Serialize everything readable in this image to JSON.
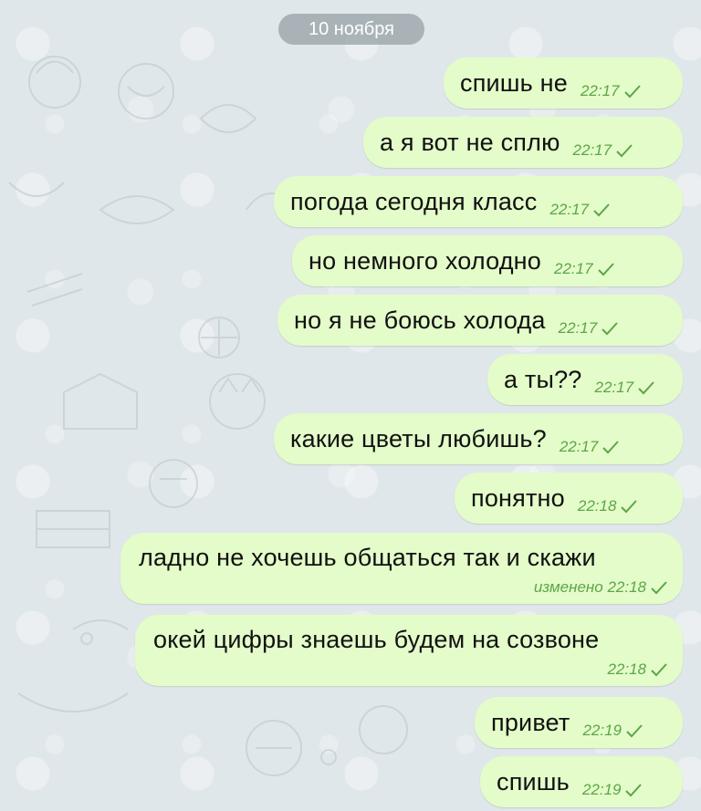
{
  "chat": {
    "date_label": "10 ноября",
    "messages": [
      {
        "text": "спишь не",
        "time": "22:17"
      },
      {
        "text": "а я вот не сплю",
        "time": "22:17"
      },
      {
        "text": "погода сегодня класс",
        "time": "22:17"
      },
      {
        "text": "но немного холодно",
        "time": "22:17"
      },
      {
        "text": "но я не боюсь холода",
        "time": "22:17"
      },
      {
        "text": "а ты??",
        "time": "22:17"
      },
      {
        "text": "какие цветы любишь?",
        "time": "22:17"
      },
      {
        "text": "понятно",
        "time": "22:18"
      },
      {
        "text": "ладно не хочешь общаться так и скажи",
        "edited": "изменено",
        "time": "22:18"
      },
      {
        "text": "окей цифры знаешь будем на созвоне",
        "time": "22:18"
      },
      {
        "text": "привет",
        "time": "22:19"
      },
      {
        "text": "спишь",
        "time": "22:19"
      }
    ]
  },
  "colors": {
    "bubble": "#e3fcc9",
    "meta": "#5ea548",
    "background": "#e0e7ea"
  },
  "icons": {
    "read_status": "check-icon"
  }
}
